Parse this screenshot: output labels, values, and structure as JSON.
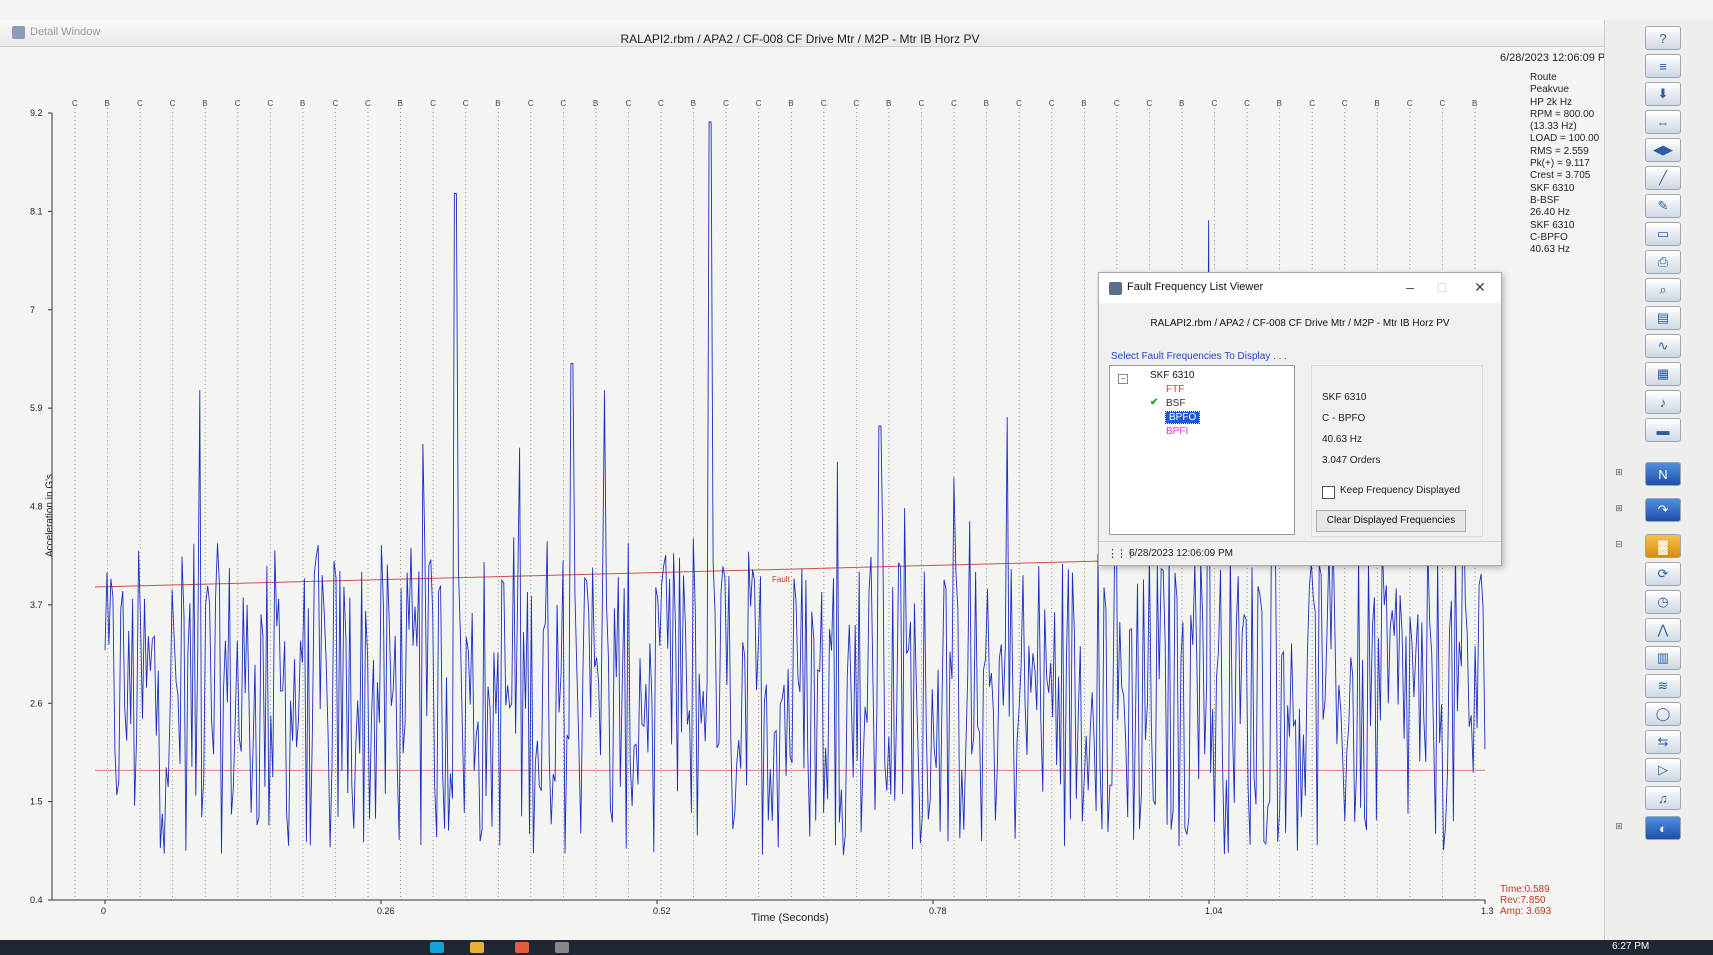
{
  "window": {
    "app_label": "Detail Window",
    "plot_title": "RALAPI2.rbm / APA2 / CF-008 CF Drive Mtr / M2P - Mtr IB Horz PV",
    "timestamp": "6/28/2023 12:06:09 PM"
  },
  "info_panel": [
    "Route",
    "Peakvue",
    "HP 2k Hz",
    "RPM = 800.00",
    "(13.33 Hz)",
    "LOAD = 100.00",
    "RMS = 2.559",
    "Pk(+) = 9.117",
    "Crest = 3.705",
    "SKF 6310",
    "B-BSF",
    "26.40 Hz",
    "SKF 6310",
    "C-BPFO",
    "40.63 Hz"
  ],
  "readout": {
    "time": "Time:0.589",
    "rev": "Rev:7.850",
    "amp": "Amp: 3.693"
  },
  "chart_data": {
    "type": "line",
    "title": "RALAPI2.rbm / APA2 / CF-008 CF Drive Mtr / M2P - Mtr IB Horz PV",
    "xlabel": "Time (Seconds)",
    "ylabel": "Acceleration in G's",
    "xlim": [
      0,
      1.3
    ],
    "ylim": [
      0.4,
      9.2
    ],
    "x_ticks": [
      "0",
      "0.26",
      "0.52",
      "0.78",
      "1.04",
      "1.3"
    ],
    "y_ticks": [
      "0.4",
      "1.5",
      "2.6",
      "3.7",
      "4.8",
      "5.9",
      "7",
      "8.1",
      "9.2"
    ],
    "series": [
      {
        "type": "peakvue-waveform",
        "color": "#1f2fbf",
        "samples": 700,
        "baseline_range": [
          0.9,
          4.4
        ],
        "peaks": [
          {
            "x": 0.09,
            "y": 6.1
          },
          {
            "x": 0.3,
            "y": 5.5
          },
          {
            "x": 0.33,
            "y": 8.3
          },
          {
            "x": 0.44,
            "y": 6.4
          },
          {
            "x": 0.47,
            "y": 6.1
          },
          {
            "x": 0.57,
            "y": 9.1
          },
          {
            "x": 0.69,
            "y": 5.3
          },
          {
            "x": 0.73,
            "y": 5.7
          },
          {
            "x": 0.85,
            "y": 5.8
          },
          {
            "x": 1.04,
            "y": 8.0
          },
          {
            "x": 1.1,
            "y": 5.2
          }
        ]
      }
    ],
    "fault_line": {
      "label": "Fault",
      "y_start": 3.9,
      "y_end": 4.3,
      "color": "#d05050"
    },
    "reference_line": {
      "y": 1.85,
      "color": "#d07070"
    },
    "marker_labels": [
      "C",
      "B",
      "C"
    ],
    "grid": "vertical dotted fault-frequency markers"
  },
  "dialog": {
    "title": "Fault Frequency List Viewer",
    "path": "RALAPI2.rbm / APA2 / CF-008 CF Drive Mtr / M2P - Mtr IB Horz PV",
    "select_label": "Select Fault Frequencies To Display . . .",
    "tree": {
      "root": "SKF 6310",
      "items": [
        {
          "label": "FTF",
          "color": "#e03b3b",
          "checked": false,
          "selected": false
        },
        {
          "label": "BSF",
          "color": "#333333",
          "checked": true,
          "selected": false
        },
        {
          "label": "BPFO",
          "color": "#ffffff",
          "checked": false,
          "selected": true
        },
        {
          "label": "BPFI",
          "color": "#d23fd2",
          "checked": false,
          "selected": false
        }
      ]
    },
    "details": {
      "bearing": "SKF 6310",
      "fault": "C - BPFO",
      "freq": "40.63 Hz",
      "orders": "3.047 Orders"
    },
    "keep_label": "Keep Frequency Displayed",
    "clear_button": "Clear Displayed Frequencies",
    "status_timestamp": "6/28/2023 12:06:09 PM"
  },
  "taskbar": {
    "clock": "6:27 PM"
  }
}
